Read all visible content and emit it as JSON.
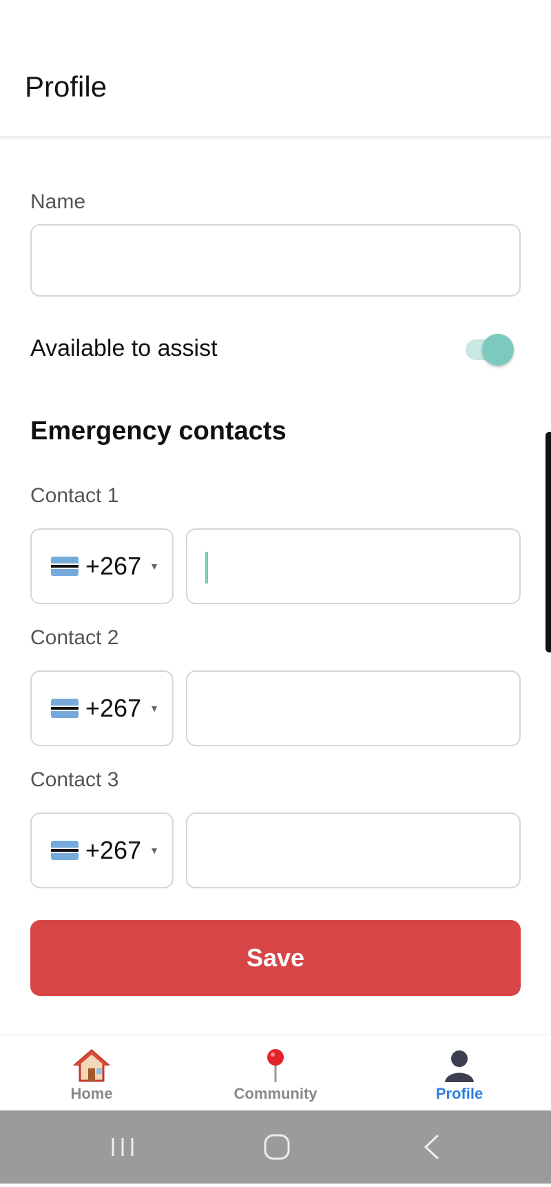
{
  "header": {
    "title": "Profile"
  },
  "form": {
    "name_label": "Name",
    "name_value": "",
    "available_label": "Available to assist",
    "available_on": true,
    "section_title": "Emergency contacts",
    "contacts": [
      {
        "label": "Contact 1",
        "country_code": "+267",
        "phone": ""
      },
      {
        "label": "Contact 2",
        "country_code": "+267",
        "phone": ""
      },
      {
        "label": "Contact 3",
        "country_code": "+267",
        "phone": ""
      }
    ],
    "save_label": "Save"
  },
  "tabs": [
    {
      "label": "Home",
      "icon": "house-icon",
      "active": false
    },
    {
      "label": "Community",
      "icon": "pin-icon",
      "active": false
    },
    {
      "label": "Profile",
      "icon": "person-silhouette-icon",
      "active": true
    }
  ],
  "system_nav": {
    "recents_icon": "recents-icon",
    "home_icon": "home-circle-icon",
    "back_icon": "back-chevron-icon"
  },
  "colors": {
    "accent": "#7cc9be",
    "save": "#d74546",
    "active_tab": "#2f7fe0",
    "system_nav": "#9b9b9b"
  }
}
